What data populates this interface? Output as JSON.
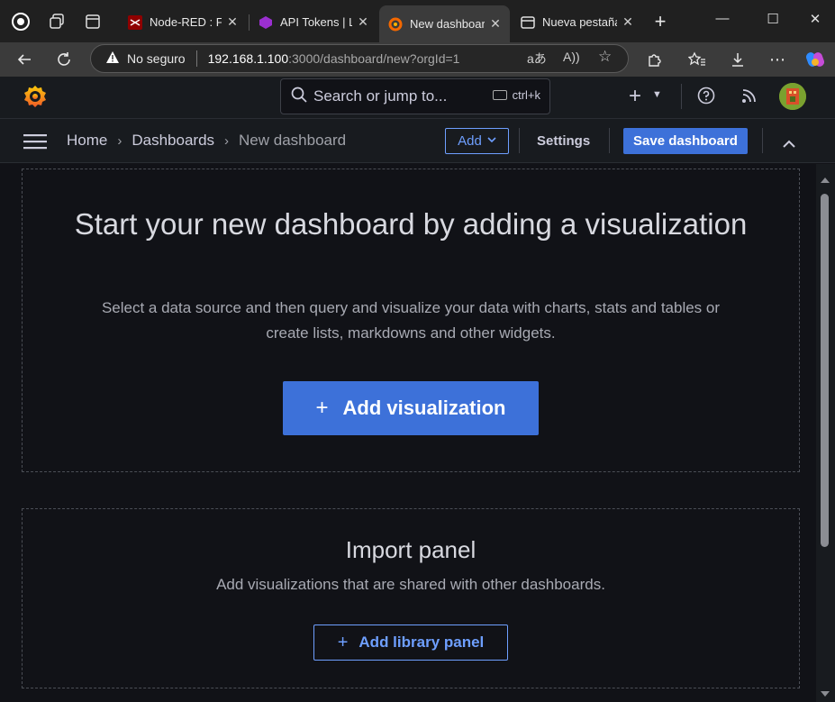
{
  "browser": {
    "tabs": [
      {
        "title": "Node-RED : Flo",
        "icon": "node-red-icon",
        "active": false
      },
      {
        "title": "API Tokens | Lo",
        "icon": "loxone-icon",
        "active": false
      },
      {
        "title": "New dashboard",
        "icon": "grafana-icon",
        "active": true
      },
      {
        "title": "Nueva pestaña",
        "icon": "new-tab-icon",
        "active": false
      }
    ],
    "address": {
      "security_label": "No seguro",
      "url_host": "192.168.1.100",
      "url_rest": ":3000/dashboard/new?orgId=1"
    }
  },
  "grafana": {
    "search_placeholder": "Search or jump to...",
    "search_shortcut": "ctrl+k",
    "breadcrumbs": [
      "Home",
      "Dashboards",
      "New dashboard"
    ],
    "add_label": "Add",
    "settings_label": "Settings",
    "save_label": "Save dashboard"
  },
  "empty_state": {
    "title": "Start your new dashboard by adding a visualization",
    "description": "Select a data source and then query and visualize your data with charts, stats and tables or create lists, markdowns and other widgets.",
    "add_viz_label": "Add visualization"
  },
  "import_panel": {
    "title": "Import panel",
    "description": "Add visualizations that are shared with other dashboards.",
    "add_library_label": "Add library panel"
  },
  "colors": {
    "primary": "#3d71d9",
    "link": "#6e9fff",
    "background": "#111217"
  }
}
